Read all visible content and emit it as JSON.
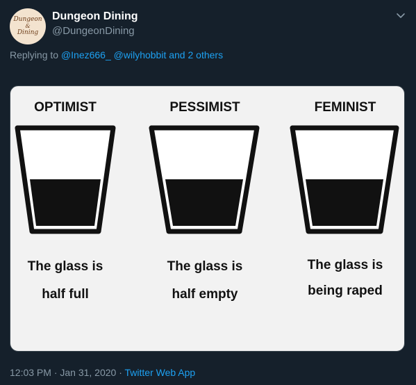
{
  "tweet": {
    "author_name": "Dungeon Dining",
    "author_handle": "@DungeonDining",
    "avatar_text": [
      "Dungeon",
      "&",
      "Dining"
    ],
    "reply_prefix": "Replying to",
    "reply_user_1": "@Inez666_",
    "reply_user_2": "@wilyhobbit",
    "reply_rest": "and 2 others",
    "timestamp": "12:03 PM · Jan 31, 2020 ·",
    "source_app": "Twitter Web App"
  },
  "meme": {
    "panels": [
      {
        "heading": "OPTIMIST",
        "caption_1": "The glass is",
        "caption_2": "half full",
        "fill_level": 0.5
      },
      {
        "heading": "PESSIMIST",
        "caption_1": "The glass is",
        "caption_2": "half empty",
        "fill_level": 0.5
      },
      {
        "heading": "FEMINIST",
        "caption_1": "The glass is",
        "caption_2": "being raped",
        "fill_level": 0.5
      }
    ]
  },
  "colors": {
    "background": "#15202b",
    "accent": "#1da1f2",
    "muted": "#8899a6"
  },
  "icons": [
    "chevron-down-icon"
  ]
}
